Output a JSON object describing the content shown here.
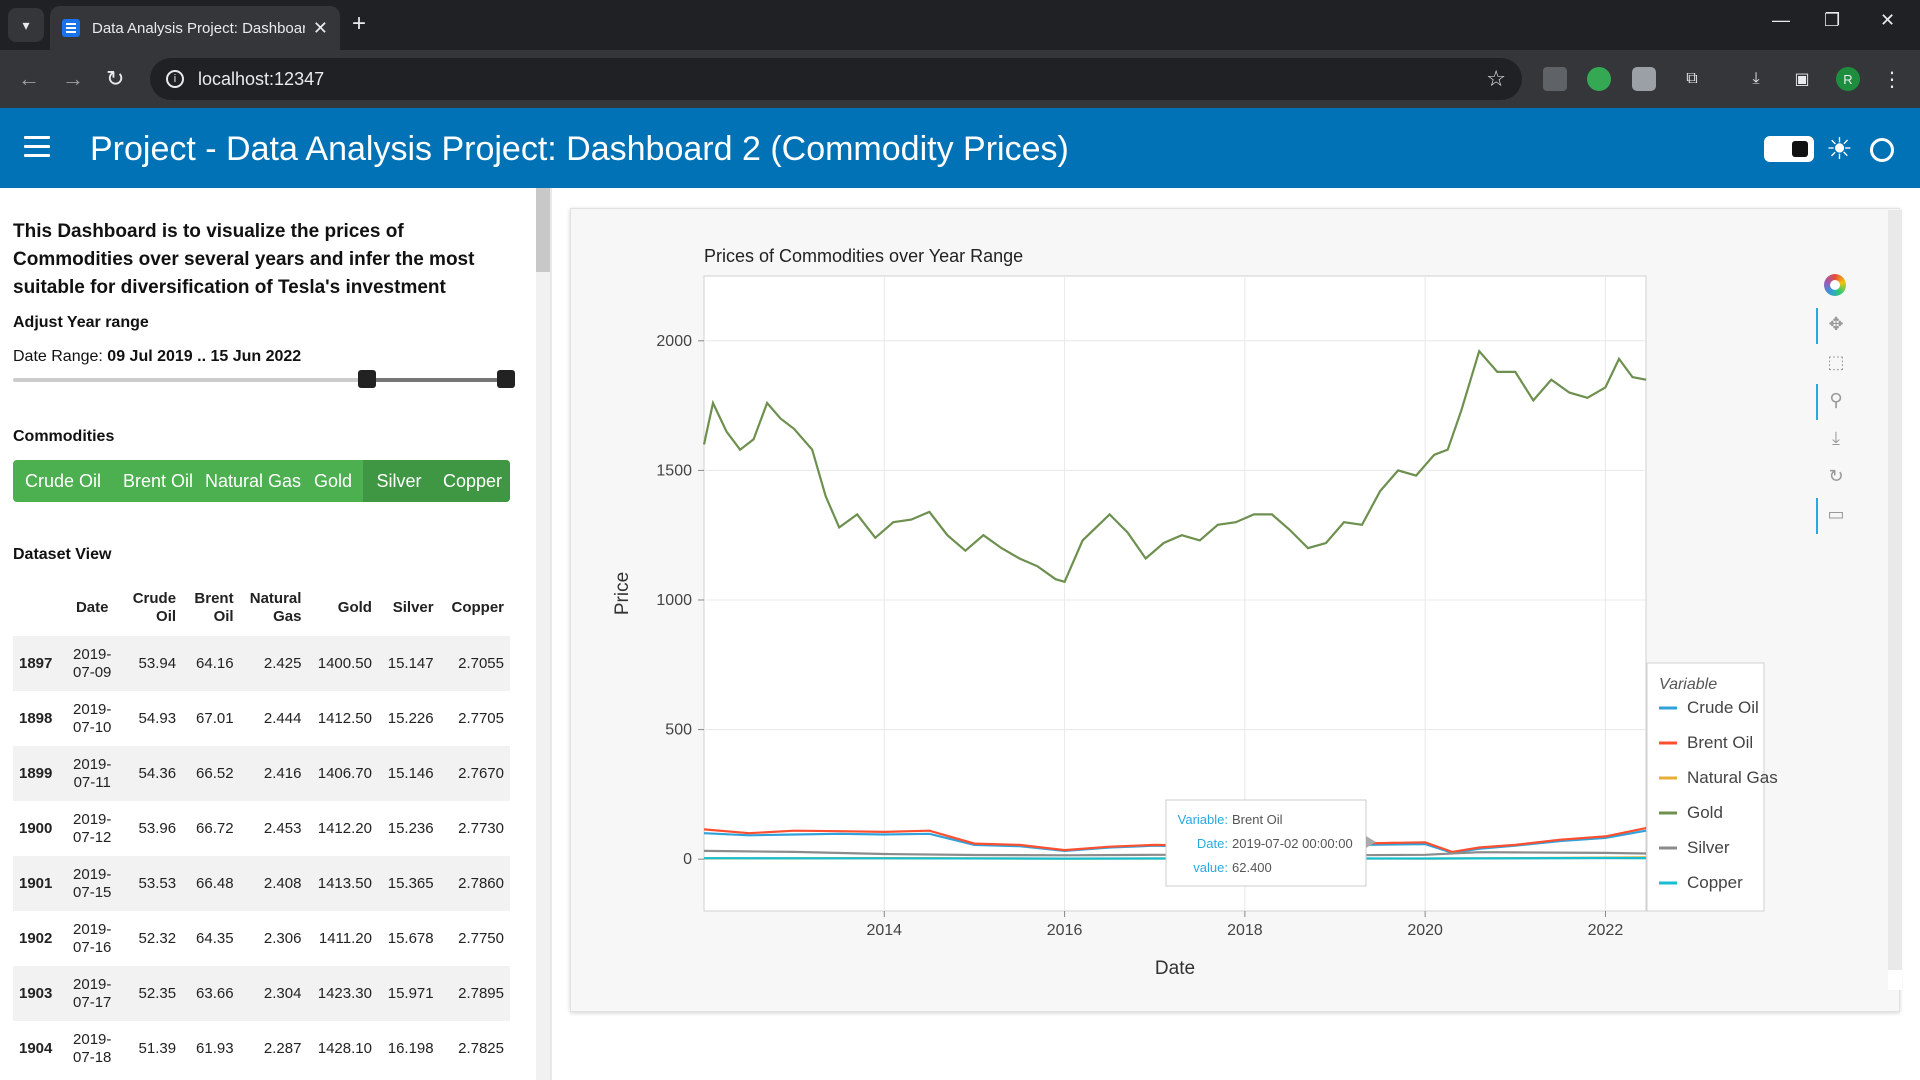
{
  "browser": {
    "tab_title": "Data Analysis Project: Dashboard",
    "tab_close": "✕",
    "new_tab": "+",
    "url": "localhost:12347",
    "profile_initial": "R"
  },
  "appbar": {
    "title": "Project  -  Data Analysis Project: Dashboard 2 (Commodity Prices)"
  },
  "sidebar": {
    "description": "This Dashboard is to visualize the prices of Commodities over several years and infer the most suitable for diversification of Tesla's investment",
    "year_range_label": "Adjust Year range",
    "date_range_prefix": "Date Range:",
    "date_range_value": "09 Jul 2019 .. 15 Jun 2022",
    "slider": {
      "start_fraction": 0.71,
      "end_fraction": 0.99
    },
    "commodities_label": "Commodities",
    "commodity_buttons": [
      {
        "label": "Crude Oil",
        "active": false
      },
      {
        "label": "Brent Oil",
        "active": false
      },
      {
        "label": "Natural Gas",
        "active": false
      },
      {
        "label": "Gold",
        "active": false
      },
      {
        "label": "Silver",
        "active": true
      },
      {
        "label": "Copper",
        "active": true
      }
    ],
    "dataset_label": "Dataset View",
    "table": {
      "headers": [
        "",
        "Date",
        "Crude Oil",
        "Brent Oil",
        "Natural Gas",
        "Gold",
        "Silver",
        "Copper"
      ],
      "rows": [
        [
          "1897",
          "2019-07-09",
          "53.94",
          "64.16",
          "2.425",
          "1400.50",
          "15.147",
          "2.7055"
        ],
        [
          "1898",
          "2019-07-10",
          "54.93",
          "67.01",
          "2.444",
          "1412.50",
          "15.226",
          "2.7705"
        ],
        [
          "1899",
          "2019-07-11",
          "54.36",
          "66.52",
          "2.416",
          "1406.70",
          "15.146",
          "2.7670"
        ],
        [
          "1900",
          "2019-07-12",
          "53.96",
          "66.72",
          "2.453",
          "1412.20",
          "15.236",
          "2.7730"
        ],
        [
          "1901",
          "2019-07-15",
          "53.53",
          "66.48",
          "2.408",
          "1413.50",
          "15.365",
          "2.7860"
        ],
        [
          "1902",
          "2019-07-16",
          "52.32",
          "64.35",
          "2.306",
          "1411.20",
          "15.678",
          "2.7750"
        ],
        [
          "1903",
          "2019-07-17",
          "52.35",
          "63.66",
          "2.304",
          "1423.30",
          "15.971",
          "2.7895"
        ],
        [
          "1904",
          "2019-07-18",
          "51.39",
          "61.93",
          "2.287",
          "1428.10",
          "16.198",
          "2.7825"
        ]
      ]
    }
  },
  "colors": {
    "appbar": "#0072b5",
    "button_green": "#4caf50",
    "crude_oil": "#30a2da",
    "brent_oil": "#fc4f30",
    "natural_gas": "#e5ae38",
    "gold": "#6d904f",
    "silver": "#8b8b8b",
    "copper": "#17becf"
  },
  "chart_data": {
    "type": "line",
    "title": "Prices of Commodities over Year Range",
    "xlabel": "Date",
    "ylabel": "Price",
    "xlim": [
      2012.0,
      2022.45
    ],
    "ylim": [
      -200,
      2250
    ],
    "x_ticks": [
      2014,
      2016,
      2018,
      2020,
      2022
    ],
    "y_ticks": [
      0,
      500,
      1000,
      1500,
      2000
    ],
    "grid": true,
    "legend": {
      "title": "Variable",
      "placement": "right"
    },
    "series": [
      {
        "name": "Crude Oil",
        "color": "#30a2da",
        "x": [
          2012.0,
          2012.5,
          2013.0,
          2013.5,
          2014.0,
          2014.5,
          2015.0,
          2015.5,
          2016.0,
          2016.5,
          2017.0,
          2017.5,
          2018.0,
          2018.5,
          2019.0,
          2019.5,
          2020.0,
          2020.3,
          2020.6,
          2021.0,
          2021.5,
          2022.0,
          2022.45
        ],
        "y": [
          100,
          92,
          95,
          98,
          95,
          98,
          55,
          50,
          32,
          45,
          52,
          48,
          62,
          68,
          53,
          56,
          58,
          25,
          40,
          52,
          70,
          82,
          110
        ]
      },
      {
        "name": "Brent Oil",
        "color": "#fc4f30",
        "x": [
          2012.0,
          2012.5,
          2013.0,
          2013.5,
          2014.0,
          2014.5,
          2015.0,
          2015.5,
          2016.0,
          2016.5,
          2017.0,
          2017.5,
          2018.0,
          2018.5,
          2019.0,
          2019.5,
          2020.0,
          2020.3,
          2020.6,
          2021.0,
          2021.5,
          2022.0,
          2022.45
        ],
        "y": [
          115,
          100,
          110,
          108,
          105,
          110,
          60,
          55,
          35,
          48,
          55,
          52,
          68,
          75,
          60,
          62,
          65,
          28,
          45,
          55,
          75,
          88,
          120
        ]
      },
      {
        "name": "Natural Gas",
        "color": "#e5ae38",
        "x": [
          2012.0,
          2014.0,
          2016.0,
          2018.0,
          2020.0,
          2022.0,
          2022.45
        ],
        "y": [
          3,
          4,
          2,
          3,
          2,
          6,
          7
        ]
      },
      {
        "name": "Gold",
        "color": "#6d904f",
        "x": [
          2012.0,
          2012.1,
          2012.25,
          2012.4,
          2012.55,
          2012.7,
          2012.85,
          2013.0,
          2013.2,
          2013.35,
          2013.5,
          2013.7,
          2013.9,
          2014.1,
          2014.3,
          2014.5,
          2014.7,
          2014.9,
          2015.1,
          2015.3,
          2015.5,
          2015.7,
          2015.9,
          2016.0,
          2016.2,
          2016.5,
          2016.7,
          2016.9,
          2017.1,
          2017.3,
          2017.5,
          2017.7,
          2017.9,
          2018.1,
          2018.3,
          2018.5,
          2018.7,
          2018.9,
          2019.1,
          2019.3,
          2019.5,
          2019.7,
          2019.9,
          2020.1,
          2020.25,
          2020.4,
          2020.6,
          2020.8,
          2021.0,
          2021.2,
          2021.4,
          2021.6,
          2021.8,
          2022.0,
          2022.15,
          2022.3,
          2022.45
        ],
        "y": [
          1600,
          1760,
          1650,
          1580,
          1620,
          1760,
          1700,
          1660,
          1580,
          1400,
          1280,
          1330,
          1240,
          1300,
          1310,
          1340,
          1250,
          1190,
          1250,
          1200,
          1160,
          1130,
          1080,
          1070,
          1230,
          1330,
          1260,
          1160,
          1220,
          1250,
          1230,
          1290,
          1300,
          1330,
          1330,
          1270,
          1200,
          1220,
          1300,
          1290,
          1420,
          1500,
          1480,
          1560,
          1580,
          1730,
          1960,
          1880,
          1880,
          1770,
          1850,
          1800,
          1780,
          1820,
          1930,
          1860,
          1850
        ]
      },
      {
        "name": "Silver",
        "color": "#8b8b8b",
        "x": [
          2012.0,
          2013.0,
          2014.0,
          2015.0,
          2016.0,
          2017.0,
          2018.0,
          2019.0,
          2020.0,
          2020.6,
          2021.0,
          2022.0,
          2022.45
        ],
        "y": [
          32,
          28,
          20,
          16,
          15,
          17,
          16,
          15,
          17,
          27,
          26,
          24,
          22
        ]
      },
      {
        "name": "Copper",
        "color": "#17becf",
        "x": [
          2012.0,
          2014.0,
          2016.0,
          2018.0,
          2020.0,
          2022.0,
          2022.45
        ],
        "y": [
          3.6,
          3.2,
          2.2,
          3.0,
          2.6,
          4.4,
          4.0
        ]
      }
    ],
    "tooltip": {
      "variable_label": "Variable:",
      "variable_value": "Brent Oil",
      "date_label": "Date:",
      "date_value": "2019-07-02 00:00:00",
      "value_label": "value:",
      "value_value": "62.400"
    }
  }
}
